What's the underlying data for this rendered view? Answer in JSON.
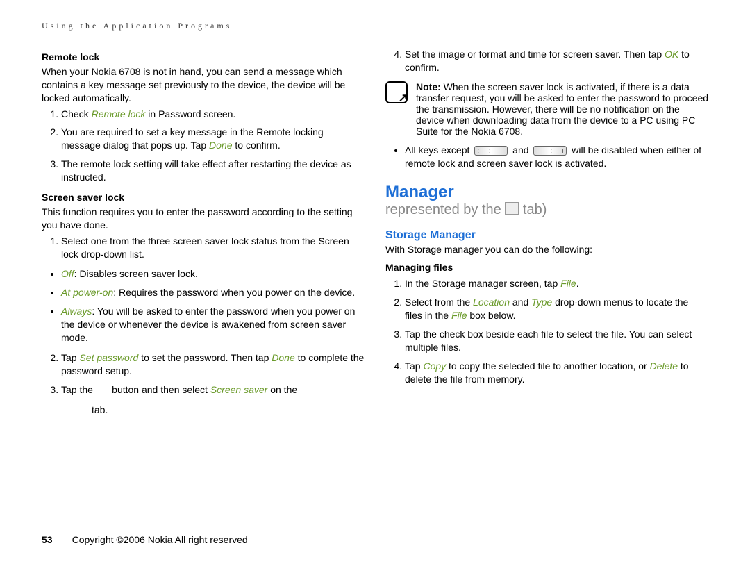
{
  "header": "Using the Application Programs",
  "leftCol": {
    "remoteLock": {
      "title": "Remote lock",
      "intro": "When your Nokia 6708 is not in hand, you can send a message which contains a key message set previously to the device, the device will be locked automatically.",
      "steps": {
        "s1a": "Check ",
        "s1b": "Remote lock",
        "s1c": " in Password screen.",
        "s2a": "You are required to set a key message in the Remote locking message dialog that pops up. Tap ",
        "s2b": "Done",
        "s2c": " to confirm.",
        "s3": "The remote lock setting will take effect after restarting the device as instructed."
      }
    },
    "screenSaverLock": {
      "title": "Screen saver lock",
      "intro": "This function requires you to enter the password according to the setting you have done.",
      "step1": "Select one from the three screen saver lock status from the Screen lock drop-down list.",
      "bullets": {
        "b1a": "Off",
        "b1b": ": Disables screen saver lock.",
        "b2a": "At power-on",
        "b2b": ": Requires the password when you power on the device.",
        "b3a": "Always",
        "b3b": ": You will be asked to enter the password when you power on the device or whenever the device is awakened from screen saver mode."
      },
      "step2a": "Tap ",
      "step2b": "Set password",
      "step2c": " to set the password. Then tap ",
      "step2d": "Done",
      "step2e": " to complete the password setup.",
      "step3a": "Tap the ",
      "step3b": " button and then select ",
      "step3c": "Screen saver",
      "step3d": " on the ",
      "step3tab": "tab."
    }
  },
  "rightCol": {
    "step4a": "Set the image or format and time for screen saver. Then tap ",
    "step4b": "OK",
    "step4c": " to confirm.",
    "noteLabel": "Note:",
    "noteText": " When the screen saver lock is activated, if there is a data transfer request, you will be asked to enter the password to proceed the transmission. However, there will be no notification on the device when downloading data from the device to a PC using PC Suite for the Nokia 6708.",
    "bulletKeysA": "All keys except ",
    "bulletKeysB": " and ",
    "bulletKeysC": " will be disabled when either of remote lock and screen saver lock is activated.",
    "manager": {
      "title": "Manager",
      "subtitleA": "represented by the ",
      "subtitleB": " tab)",
      "storageTitle": "Storage Manager",
      "storageIntro": "With Storage manager you can do the following:",
      "managingFiles": "Managing files",
      "steps": {
        "s1a": "In the Storage manager screen, tap ",
        "s1b": "File",
        "s1c": ".",
        "s2a": "Select from the ",
        "s2b": "Location",
        "s2c": " and ",
        "s2d": "Type",
        "s2e": " drop-down menus to locate the files in the ",
        "s2f": "File",
        "s2g": " box below.",
        "s3": "Tap the check box beside each file to select the file. You can select multiple files.",
        "s4a": "Tap ",
        "s4b": "Copy",
        "s4c": " to copy the selected file to another location, or ",
        "s4d": "Delete",
        "s4e": " to delete the file from memory."
      }
    }
  },
  "footer": {
    "pageNum": "53",
    "copyright": "Copyright ©2006 Nokia All right reserved"
  }
}
